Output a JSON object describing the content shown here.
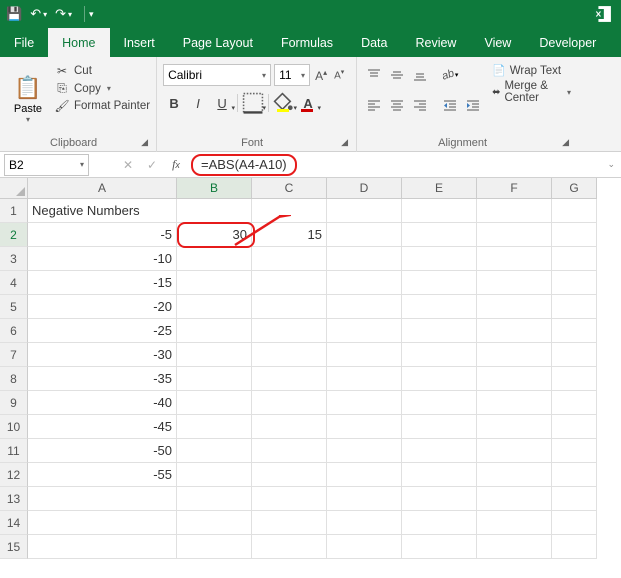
{
  "titlebar": {
    "save": "💾",
    "undo": "↶",
    "redo": "↷"
  },
  "tabs": {
    "file": "File",
    "home": "Home",
    "insert": "Insert",
    "pagelayout": "Page Layout",
    "formulas": "Formulas",
    "data": "Data",
    "review": "Review",
    "view": "View",
    "developer": "Developer"
  },
  "ribbon": {
    "clipboard": {
      "paste": "Paste",
      "cut": "Cut",
      "copy": "Copy",
      "painter": "Format Painter",
      "label": "Clipboard"
    },
    "font": {
      "name": "Calibri",
      "size": "11",
      "label": "Font"
    },
    "align": {
      "wrap": "Wrap Text",
      "merge": "Merge & Center",
      "label": "Alignment"
    }
  },
  "fx": {
    "namebox": "B2",
    "formula": "=ABS(A4-A10)"
  },
  "grid": {
    "cols": [
      "A",
      "B",
      "C",
      "D",
      "E",
      "F",
      "G"
    ],
    "rows": [
      {
        "n": 1,
        "A": "Negative Numbers",
        "B": "",
        "C": ""
      },
      {
        "n": 2,
        "A": "-5",
        "B": "30",
        "C": "15"
      },
      {
        "n": 3,
        "A": "-10",
        "B": "",
        "C": ""
      },
      {
        "n": 4,
        "A": "-15",
        "B": "",
        "C": ""
      },
      {
        "n": 5,
        "A": "-20",
        "B": "",
        "C": ""
      },
      {
        "n": 6,
        "A": "-25",
        "B": "",
        "C": ""
      },
      {
        "n": 7,
        "A": "-30",
        "B": "",
        "C": ""
      },
      {
        "n": 8,
        "A": "-35",
        "B": "",
        "C": ""
      },
      {
        "n": 9,
        "A": "-40",
        "B": "",
        "C": ""
      },
      {
        "n": 10,
        "A": "-45",
        "B": "",
        "C": ""
      },
      {
        "n": 11,
        "A": "-50",
        "B": "",
        "C": ""
      },
      {
        "n": 12,
        "A": "-55",
        "B": "",
        "C": ""
      },
      {
        "n": 13,
        "A": "",
        "B": "",
        "C": ""
      },
      {
        "n": 14,
        "A": "",
        "B": "",
        "C": ""
      },
      {
        "n": 15,
        "A": "",
        "B": "",
        "C": ""
      }
    ]
  }
}
